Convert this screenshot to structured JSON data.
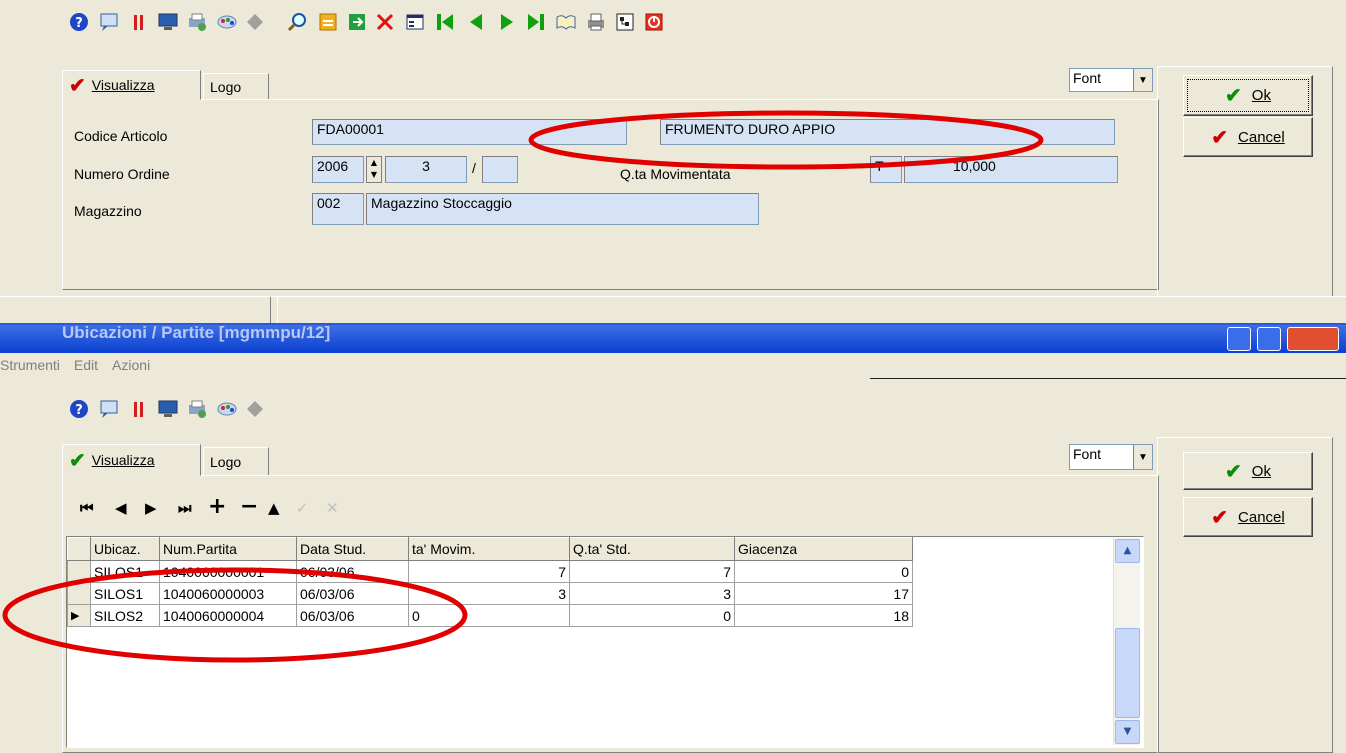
{
  "top": {
    "toolbar_icons": [
      "help-icon",
      "preview-icon",
      "split-icon",
      "monitor-icon",
      "print-preview-icon",
      "palette-icon",
      "diamond-icon",
      "search-icon",
      "open-icon",
      "export-icon",
      "delete-icon",
      "form-icon",
      "first-icon",
      "prev-icon",
      "next-icon",
      "last-icon",
      "book-icon",
      "printer-icon",
      "tree-icon",
      "exit-icon"
    ],
    "tabs": [
      "Visualizza",
      "Logo"
    ],
    "font_label": "Font",
    "ok_label": "Ok",
    "cancel_label": "Cancel",
    "fields": {
      "codice_label": "Codice Articolo",
      "codice_value": "FDA00001",
      "descrizione_value": "FRUMENTO DURO APPIO",
      "ordine_label": "Numero Ordine",
      "anno_value": "2006",
      "numero_value": "3",
      "qta_label": "Q.ta Movimentata",
      "unit_value": "T",
      "qta_value": "10,000",
      "magazzino_label": "Magazzino",
      "magazzino_code": "002",
      "magazzino_name": "Magazzino Stoccaggio"
    }
  },
  "bottom": {
    "window_title": "Ubicazioni / Partite [mgmmpu/12]",
    "menu": [
      "Strumenti",
      "Edit",
      "Azioni"
    ],
    "tabs": [
      "Visualizza",
      "Logo"
    ],
    "font_label": "Font",
    "ok_label": "Ok",
    "cancel_label": "Cancel",
    "grid": {
      "columns": [
        "Ubicaz.",
        "Num.Partita",
        "Data Stud.",
        "ta' Movim.",
        "Q.ta' Std.",
        "Giacenza"
      ],
      "rows": [
        [
          "SILOS1",
          "1040060000001",
          "06/03/06",
          "7",
          "7",
          "0"
        ],
        [
          "SILOS1",
          "1040060000003",
          "06/03/06",
          "3",
          "3",
          "17"
        ],
        [
          "SILOS2",
          "1040060000004",
          "06/03/06",
          "0",
          "0",
          "18"
        ]
      ]
    }
  },
  "colors": {
    "annotation": "#e00000",
    "field_bg": "#d6e3f5",
    "title_blue": "#0a3fd0"
  }
}
